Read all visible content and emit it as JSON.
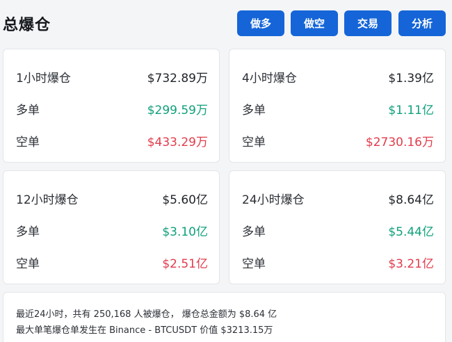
{
  "header": {
    "title": "总爆仓",
    "buttons": [
      {
        "label": "做多"
      },
      {
        "label": "做空"
      },
      {
        "label": "交易"
      },
      {
        "label": "分析"
      }
    ]
  },
  "cards": [
    {
      "title": "1小时爆仓",
      "total": "$732.89万",
      "long_label": "多单",
      "long_value": "$299.59万",
      "short_label": "空单",
      "short_value": "$433.29万"
    },
    {
      "title": "4小时爆仓",
      "total": "$1.39亿",
      "long_label": "多单",
      "long_value": "$1.11亿",
      "short_label": "空单",
      "short_value": "$2730.16万"
    },
    {
      "title": "12小时爆仓",
      "total": "$5.60亿",
      "long_label": "多单",
      "long_value": "$3.10亿",
      "short_label": "空单",
      "short_value": "$2.51亿"
    },
    {
      "title": "24小时爆仓",
      "total": "$8.64亿",
      "long_label": "多单",
      "long_value": "$5.44亿",
      "short_label": "空单",
      "short_value": "$3.21亿"
    }
  ],
  "summary": {
    "line1": "最近24小时，共有 250,168 人被爆仓， 爆仓总金额为 $8.64 亿",
    "line2": "最大单笔爆仓单发生在 Binance - BTCUSDT 价值 $3213.15万"
  },
  "colors": {
    "accent": "#1565d8",
    "long": "#0fa07a",
    "short": "#e23b4b"
  }
}
